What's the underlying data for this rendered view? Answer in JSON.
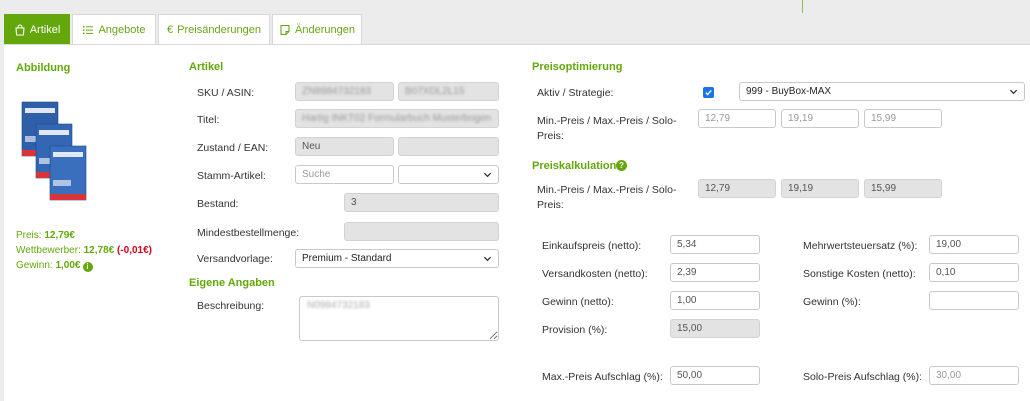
{
  "tabs": [
    {
      "label": "Artikel",
      "icon": "bag-icon",
      "active": true
    },
    {
      "label": "Angebote",
      "icon": "list-icon",
      "active": false
    },
    {
      "label": "Preisänderungen",
      "icon": "euro-icon",
      "active": false
    },
    {
      "label": "Änderungen",
      "icon": "note-icon",
      "active": false
    }
  ],
  "abbildung": {
    "title": "Abbildung",
    "preis_label": "Preis:",
    "preis_value": "12,79€",
    "wettbewerber_label": "Wettbewerber:",
    "wettbewerber_value": "12,78€",
    "wettbewerber_diff": "(-0,01€)",
    "gewinn_label": "Gewinn:",
    "gewinn_value": "1,00€"
  },
  "artikel": {
    "title": "Artikel",
    "sku_label": "SKU / ASIN:",
    "sku_value": "ZN8984732183",
    "asin_value": "B07XDL2L15",
    "titel_label": "Titel:",
    "titel_value": "Hartig INKT02 Formularbuch Musterbogen",
    "zustand_label": "Zustand / EAN:",
    "zustand_value": "Neu",
    "ean_value": "",
    "stamm_label": "Stamm-Artikel:",
    "stamm_placeholder": "Suche",
    "stamm_select": "",
    "bestand_label": "Bestand:",
    "bestand_value": "3",
    "mindest_label": "Mindestbestellmenge:",
    "mindest_value": "",
    "versand_label": "Versandvorlage:",
    "versand_value": "Premium - Standard"
  },
  "eigene": {
    "title": "Eigene Angaben",
    "beschreibung_label": "Beschreibung:",
    "beschreibung_value": "N0984732183"
  },
  "preisoptimierung": {
    "title": "Preisoptimierung",
    "aktiv_label": "Aktiv / Strategie:",
    "aktiv_checked": true,
    "strategie_value": "999 - BuyBox-MAX",
    "minmax_label": "Min.-Preis / Max.-Preis / Solo-Preis:",
    "min_value": "12,79",
    "max_value": "19,19",
    "solo_value": "15,99"
  },
  "preiskalkulation": {
    "title": "Preiskalkulation",
    "minmax_label": "Min.-Preis / Max.-Preis / Solo-Preis:",
    "min_value": "12,79",
    "max_value": "19,19",
    "solo_value": "15,99",
    "einkauf_label": "Einkaufspreis (netto):",
    "einkauf_value": "5,34",
    "versandkosten_label": "Versandkosten (netto):",
    "versandkosten_value": "2,39",
    "gewinn_netto_label": "Gewinn (netto):",
    "gewinn_netto_value": "1,00",
    "provision_label": "Provision (%):",
    "provision_value": "15,00",
    "mwst_label": "Mehrwertsteuersatz (%):",
    "mwst_value": "19,00",
    "sonstige_label": "Sonstige Kosten (netto):",
    "sonstige_value": "0,10",
    "gewinn_pct_label": "Gewinn (%):",
    "gewinn_pct_value": "",
    "maxaufschlag_label": "Max.-Preis Aufschlag (%):",
    "maxaufschlag_value": "50,00",
    "soloaufschlag_label": "Solo-Preis Aufschlag (%):",
    "soloaufschlag_value": "30,00"
  },
  "colors": {
    "accent": "#64a70b",
    "negative": "#d0021b",
    "checkbox": "#1a73e8"
  }
}
